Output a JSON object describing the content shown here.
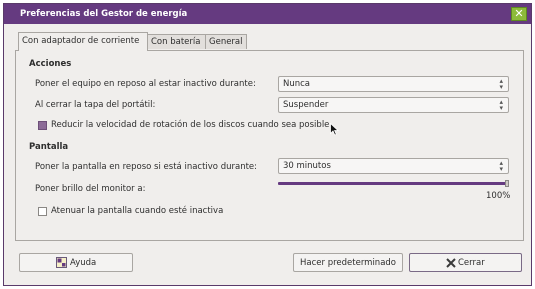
{
  "window": {
    "title": "Preferencias del Gestor de energía",
    "close_glyph": "✕"
  },
  "tabs": [
    {
      "label": "Con adaptador de corriente",
      "active": true
    },
    {
      "label": "Con batería",
      "active": false
    },
    {
      "label": "General",
      "active": false
    }
  ],
  "acciones": {
    "title": "Acciones",
    "suspend_label": "Poner el equipo en reposo al estar inactivo durante:",
    "suspend_value": "Nunca",
    "lid_label": "Al cerrar la tapa del portátil:",
    "lid_value": "Suspender",
    "spindown_label": "Reducir la velocidad de rotación de los discos cuando sea posible",
    "spindown_checked": true
  },
  "pantalla": {
    "title": "Pantalla",
    "sleep_label": "Poner la pantalla en reposo si está inactivo durante:",
    "sleep_value": "30 minutos",
    "brightness_label": "Poner brillo del monitor a:",
    "brightness_value": "100%",
    "brightness_level": 1.0,
    "dim_label": "Atenuar la pantalla cuando esté inactiva",
    "dim_checked": false
  },
  "buttons": {
    "help": "Ayuda",
    "defaults": "Hacer predeterminado",
    "close": "Cerrar"
  },
  "colors": {
    "titlebar": "#653a80",
    "close_button": "#8dbb3a",
    "slider_fill": "#653a80"
  },
  "icons": {
    "help": "help-icon",
    "close": "close-icon",
    "combo_arrow": "up-down-arrows-icon",
    "cursor": "mouse-pointer-icon"
  }
}
